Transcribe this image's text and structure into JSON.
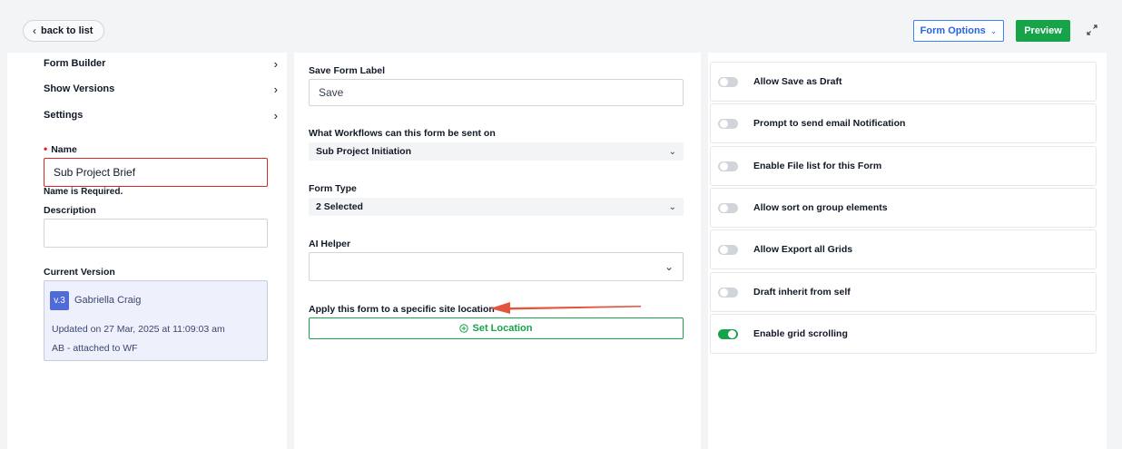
{
  "topbar": {
    "back_label": "back to list",
    "form_options_label": "Form Options",
    "preview_label": "Preview"
  },
  "left": {
    "nav": [
      {
        "label": "Form Builder"
      },
      {
        "label": "Show Versions"
      },
      {
        "label": "Settings"
      }
    ],
    "name_label": "Name",
    "name_value": "Sub Project Brief",
    "name_error": "Name is Required.",
    "description_label": "Description",
    "description_value": "",
    "current_version_label": "Current Version",
    "version": {
      "badge": "v.3",
      "author": "Gabriella Craig",
      "updated": "Updated on 27 Mar, 2025 at 11:09:03 am",
      "note": "AB - attached to WF"
    }
  },
  "middle": {
    "save_label_title": "Save Form Label",
    "save_label_value": "Save",
    "workflows_title": "What Workflows can this form be sent on",
    "workflows_value": "Sub Project Initiation",
    "form_type_title": "Form Type",
    "form_type_value": "2 Selected",
    "ai_helper_title": "AI Helper",
    "ai_helper_value": "",
    "location_title": "Apply this form to a specific site location",
    "set_location_label": "Set Location"
  },
  "right": {
    "toggles": [
      {
        "label": "Allow Save as Draft",
        "on": false
      },
      {
        "label": "Prompt to send email Notification",
        "on": false
      },
      {
        "label": "Enable File list for this Form",
        "on": false
      },
      {
        "label": "Allow sort on group elements",
        "on": false
      },
      {
        "label": "Allow Export all Grids",
        "on": false
      },
      {
        "label": "Draft inherit from self",
        "on": false
      },
      {
        "label": "Enable grid scrolling",
        "on": true
      }
    ]
  },
  "colors": {
    "accent_blue": "#2563eb",
    "accent_green": "#16a34a",
    "error_red": "#dc2626",
    "annotation_arrow": "#e2553f"
  }
}
